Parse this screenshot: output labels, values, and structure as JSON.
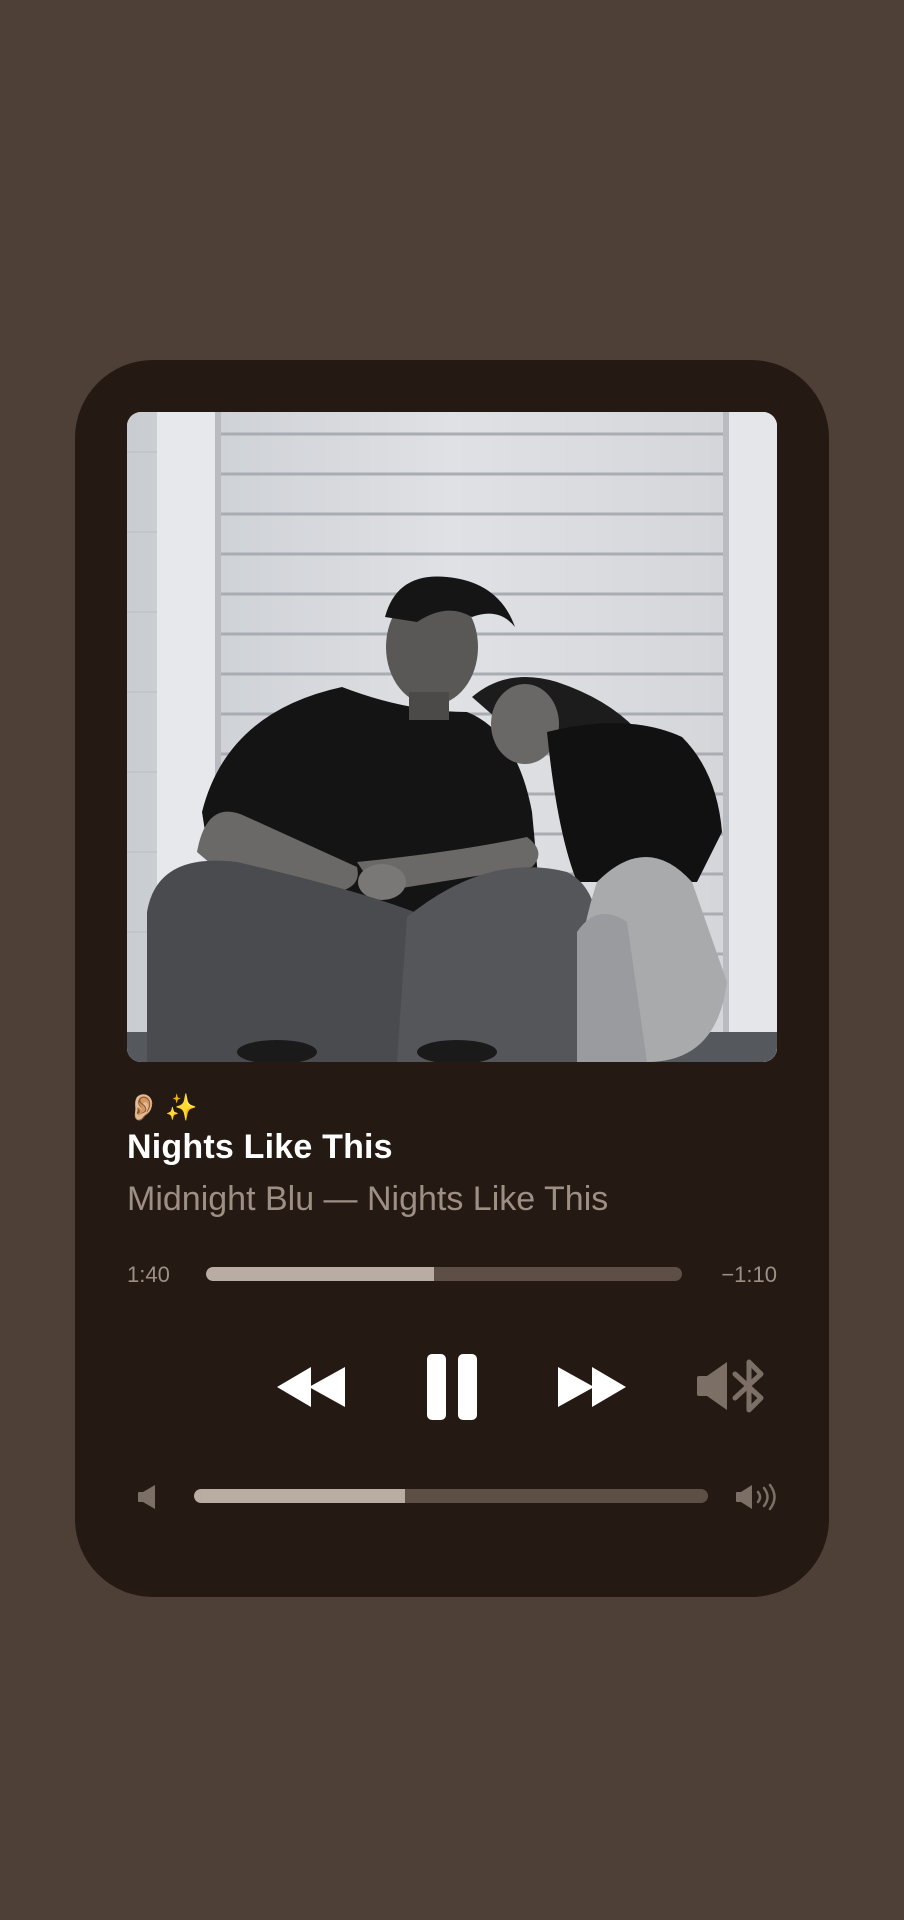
{
  "now_playing": {
    "emojis": [
      "👂🏼",
      "✨"
    ],
    "title": "Nights Like This",
    "subtitle": "Midnight Blu — Nights Like This",
    "time_elapsed": "1:40",
    "time_remaining": "−1:10",
    "progress_fraction": 0.48,
    "volume_fraction": 0.41
  },
  "controls": {
    "rewind_icon": "rewind-icon",
    "pause_icon": "pause-icon",
    "forward_icon": "fast-forward-icon",
    "output_icon": "bluetooth-speaker-icon",
    "volume_low_icon": "volume-low-icon",
    "volume_high_icon": "volume-high-icon"
  },
  "colors": {
    "background": "#4e4036",
    "card": "#251a13",
    "title": "#ffffff",
    "secondary_text": "#9d8f84",
    "track": "#5d4f45",
    "track_fill": "#b9aca2"
  }
}
